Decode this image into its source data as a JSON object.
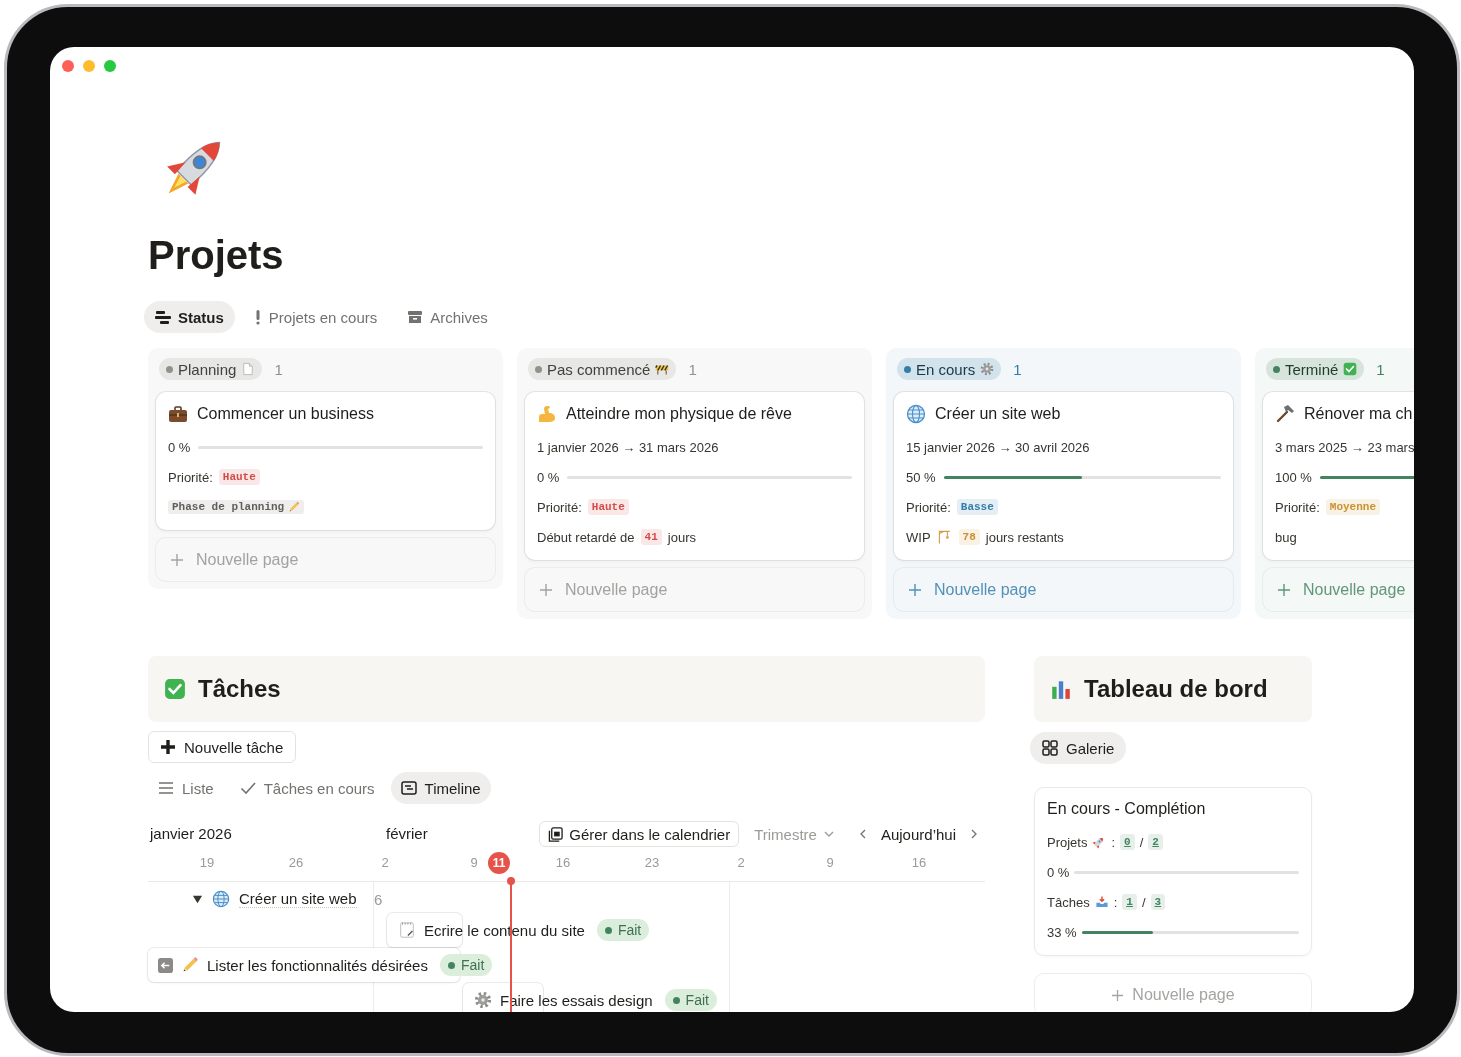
{
  "page": {
    "title": "Projets"
  },
  "views": [
    {
      "label": "Status",
      "kind": "board",
      "selected": true
    },
    {
      "label": "Projets en cours",
      "kind": "alert",
      "selected": false
    },
    {
      "label": "Archives",
      "kind": "archive",
      "selected": false
    }
  ],
  "board": {
    "columns": [
      {
        "status": "Planning",
        "kind": "planning",
        "color": "#91918e",
        "count": "1",
        "new_page": "Nouvelle page",
        "cards": [
          {
            "title": "Commencer un business",
            "progress": {
              "reading": "0 %",
              "level": 0
            },
            "priority": {
              "label": "Priorité:",
              "value": "Haute",
              "color": "#d44c47"
            },
            "note": [
              {
                "kind": "tag",
                "text": "Phase de planning"
              }
            ]
          }
        ]
      },
      {
        "status": "Pas commencé",
        "kind": "not_started",
        "color": "#91918e",
        "count": "1",
        "new_page": "Nouvelle page",
        "cards": [
          {
            "title": "Atteindre mon physique de rêve",
            "dates": "1 janvier 2026 → 31 mars 2026",
            "progress": {
              "reading": "0 %",
              "level": 0
            },
            "priority": {
              "label": "Priorité:",
              "value": "Haute",
              "color": "#d44c47"
            },
            "note": [
              {
                "kind": "text",
                "text": "Début retardé de"
              },
              {
                "kind": "code",
                "text": "41",
                "color": "#d44c47"
              },
              {
                "kind": "text",
                "text": "jours"
              }
            ]
          }
        ]
      },
      {
        "status": "En cours",
        "kind": "in_progress",
        "color": "#337ea9",
        "count": "1",
        "new_page": "Nouvelle page",
        "cards": [
          {
            "title": "Créer un site web",
            "dates": "15 janvier 2026 → 30 avril 2026",
            "progress": {
              "reading": "50 %",
              "level": 0.5
            },
            "priority": {
              "label": "Priorité:",
              "value": "Basse",
              "color": "#337ea9"
            },
            "note": [
              {
                "kind": "text",
                "text": "WIP"
              },
              {
                "kind": "icon"
              },
              {
                "kind": "code",
                "text": "78",
                "color": "#cb912f"
              },
              {
                "kind": "text",
                "text": "jours restants"
              }
            ]
          }
        ]
      },
      {
        "status": "Terminé",
        "kind": "done",
        "color": "#448361",
        "count": "1",
        "new_page": "Nouvelle page",
        "cards": [
          {
            "title": "Rénover ma ch",
            "dates": "3 mars 2025 → 23 mars",
            "progress": {
              "reading": "100 %",
              "level": 1
            },
            "priority": {
              "label": "Priorité:",
              "value": "Moyenne",
              "color": "#cb912f"
            },
            "note": [
              {
                "kind": "text",
                "text": "bug"
              }
            ]
          }
        ]
      }
    ]
  },
  "tasks": {
    "title": "Tâches",
    "new_button": "Nouvelle tâche",
    "views": [
      {
        "label": "Liste",
        "kind": "list",
        "selected": false
      },
      {
        "label": "Tâches en cours",
        "kind": "check",
        "selected": false
      },
      {
        "label": "Timeline",
        "kind": "timeline",
        "selected": true
      }
    ],
    "timeline": {
      "start_month": "janvier 2026",
      "calendar_button": "Gérer dans le calendrier",
      "scale": "Trimestre",
      "today_button": "Aujourd’hui",
      "ticks": [
        {
          "label": "19",
          "today": false,
          "month_start": false
        },
        {
          "label": "26",
          "today": false,
          "month_start": false
        },
        {
          "label": "2",
          "month": "février",
          "today": false,
          "month_start": true
        },
        {
          "label": "9",
          "today": false,
          "month_start": false
        },
        {
          "label": "11",
          "today": true,
          "month_start": false
        },
        {
          "label": "16",
          "today": false,
          "month_start": false
        },
        {
          "label": "23",
          "today": false,
          "month_start": false
        },
        {
          "label": "2",
          "today": false,
          "month_start": true
        },
        {
          "label": "9",
          "today": false,
          "month_start": false
        },
        {
          "label": "16",
          "today": false,
          "month_start": false
        }
      ],
      "rows": [
        {
          "kind": "group",
          "title": "Créer un site web",
          "count": "6",
          "expanded": true
        },
        {
          "kind": "task",
          "title": "Ecrire le contenu du site",
          "status": "Fait",
          "starts_before": false
        },
        {
          "kind": "task",
          "title": "Lister les fonctionnalités désirées",
          "status": "Fait",
          "starts_before": true
        },
        {
          "kind": "task",
          "title": "Faire les essais design",
          "status": "Fait",
          "starts_before": false
        }
      ]
    }
  },
  "dashboard": {
    "title": "Tableau de bord",
    "views": [
      {
        "label": "Galerie",
        "kind": "gallery",
        "selected": true
      }
    ],
    "cards": [
      {
        "title": "En cours - Complétion",
        "stats": [
          {
            "label": "Projets",
            "suffix": ":",
            "done": "0",
            "separator": "/",
            "total": "2",
            "reading": "0 %",
            "level": 0
          },
          {
            "label": "Tâches",
            "suffix": ":",
            "done": "1",
            "separator": "/",
            "total": "3",
            "reading": "33 %",
            "level": 0.33
          }
        ]
      }
    ],
    "new_page": "Nouvelle page"
  }
}
